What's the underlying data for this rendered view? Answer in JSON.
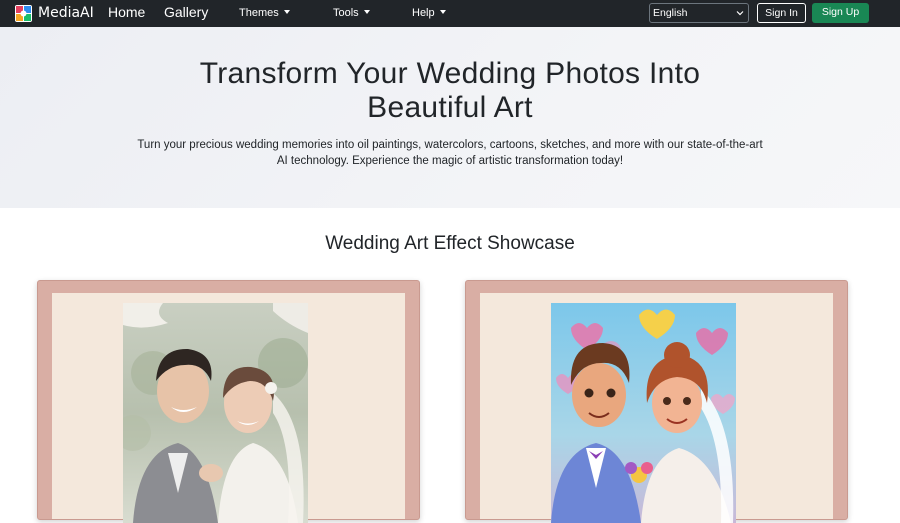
{
  "navbar": {
    "brand": "MediaAI",
    "links": {
      "home": "Home",
      "gallery": "Gallery"
    },
    "dropdowns": {
      "themes": "Themes",
      "tools": "Tools",
      "help": "Help"
    },
    "language": {
      "selected": "English"
    },
    "signin_label": "Sign In",
    "signup_label": "Sign Up"
  },
  "hero": {
    "title_line1": "Transform Your Wedding Photos Into",
    "title_line2": "Beautiful Art",
    "subtitle_line1": "Turn your precious wedding memories into oil paintings, watercolors, cartoons, sketches, and more with our state-of-the-art",
    "subtitle_line2": "AI technology. Experience the magic of artistic transformation today!"
  },
  "showcase": {
    "title": "Wedding Art Effect Showcase"
  },
  "colors": {
    "navbar_bg": "#212529",
    "signup_green": "#198754",
    "card_frame": "#d9aea4",
    "card_mat": "#f4e8dc"
  },
  "icons": {
    "brand": "mediaai-logo-icon",
    "dropdown": "caret-down-icon",
    "select": "chevron-down-icon"
  }
}
